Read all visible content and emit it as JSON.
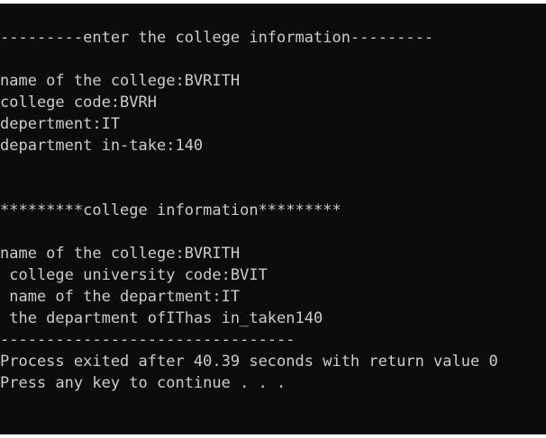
{
  "console": {
    "lines": [
      "---------enter the college information---------",
      "",
      "name of the college:BVRITH",
      "college code:BVRH",
      "depertment:IT",
      "department in-take:140",
      "",
      "",
      "*********college information*********",
      "",
      "name of the college:BVRITH",
      " college university code:BVIT",
      " name of the department:IT",
      " the department ofIThas in_taken140",
      "--------------------------------",
      "Process exited after 40.39 seconds with return value 0",
      "Press any key to continue . . ."
    ]
  }
}
